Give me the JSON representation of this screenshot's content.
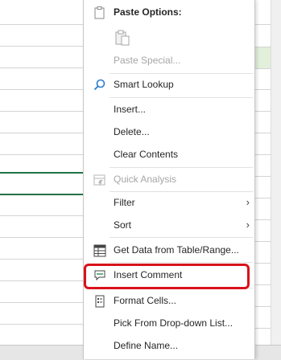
{
  "menu": {
    "paste_options_label": "Paste Options:",
    "paste_special": "Paste Special...",
    "smart_lookup": "Smart Lookup",
    "insert": "Insert...",
    "delete": "Delete...",
    "clear_contents": "Clear Contents",
    "quick_analysis": "Quick Analysis",
    "filter": "Filter",
    "sort": "Sort",
    "get_data": "Get Data from Table/Range...",
    "insert_comment": "Insert Comment",
    "format_cells": "Format Cells...",
    "pick_dropdown": "Pick From Drop-down List...",
    "define_name": "Define Name..."
  },
  "icons": {
    "paste_options": "clipboard-icon",
    "paste_keep": "paste-icon",
    "smart_lookup": "search-icon",
    "quick_analysis": "quick-analysis-icon",
    "get_data": "table-icon",
    "insert_comment": "comment-icon",
    "format_cells": "format-cells-icon",
    "submenu_arrow": "chevron-right-icon"
  },
  "colors": {
    "highlight": "#d9121b",
    "selection_green": "#217346",
    "disabled_text": "#a6a6a6"
  }
}
